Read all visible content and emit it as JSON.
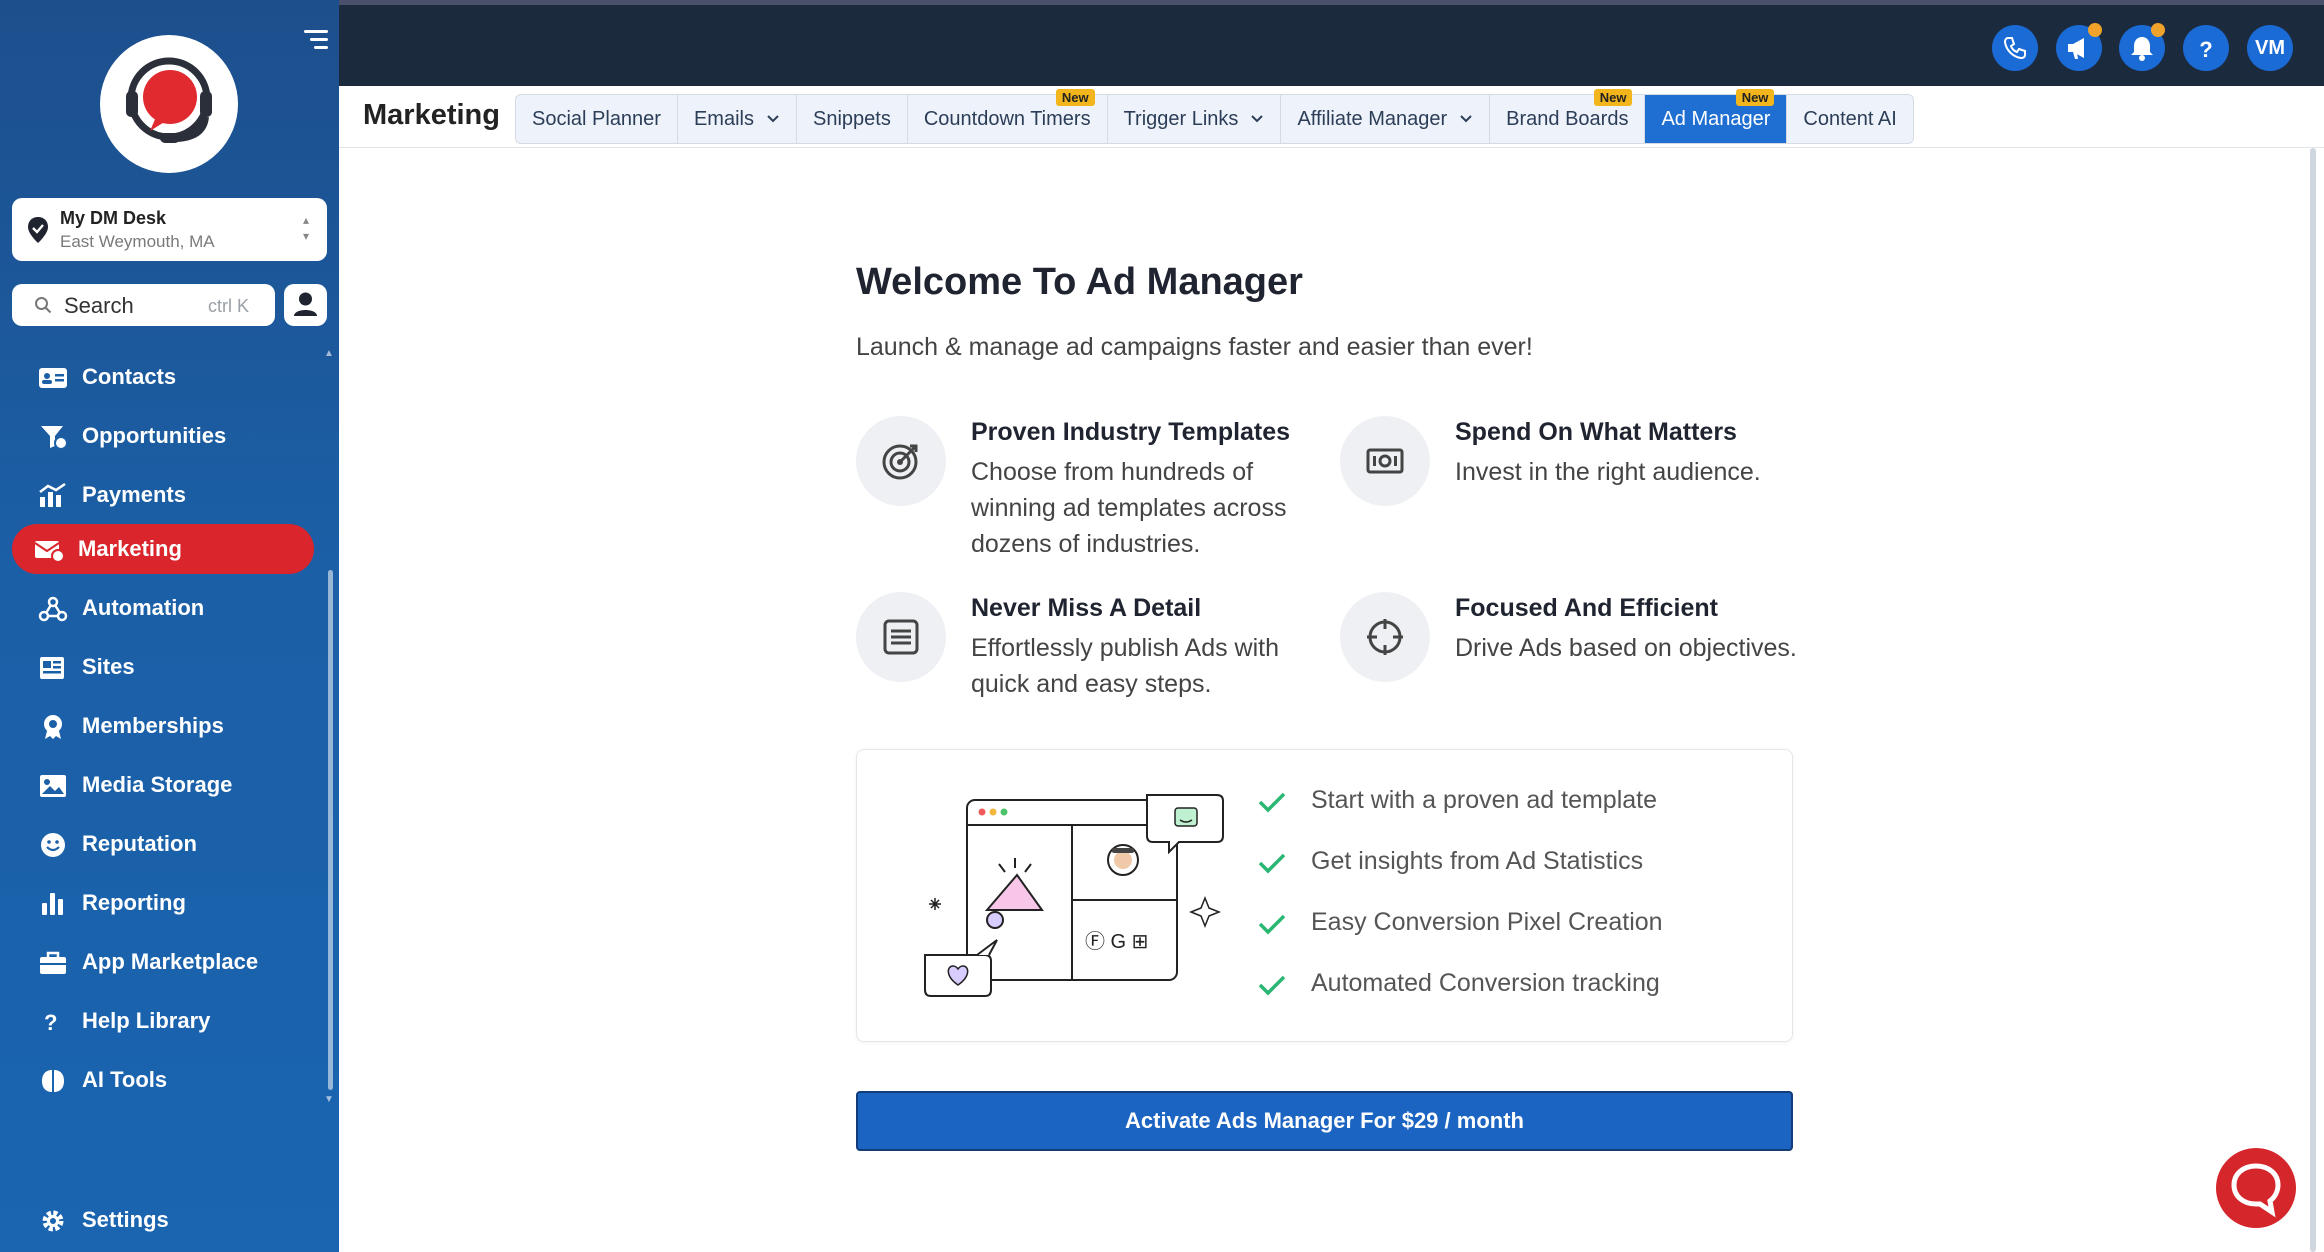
{
  "sidebar": {
    "location": {
      "name": "My DM Desk",
      "address": "East Weymouth, MA"
    },
    "search": {
      "label": "Search",
      "shortcut": "ctrl K"
    },
    "items": [
      {
        "label": "Contacts",
        "icon": "contacts-icon"
      },
      {
        "label": "Opportunities",
        "icon": "opportunities-icon"
      },
      {
        "label": "Payments",
        "icon": "payments-icon"
      },
      {
        "label": "Marketing",
        "icon": "marketing-icon",
        "active": true
      },
      {
        "label": "Automation",
        "icon": "automation-icon"
      },
      {
        "label": "Sites",
        "icon": "sites-icon"
      },
      {
        "label": "Memberships",
        "icon": "memberships-icon"
      },
      {
        "label": "Media Storage",
        "icon": "media-storage-icon"
      },
      {
        "label": "Reputation",
        "icon": "reputation-icon"
      },
      {
        "label": "Reporting",
        "icon": "reporting-icon"
      },
      {
        "label": "App Marketplace",
        "icon": "app-marketplace-icon"
      },
      {
        "label": "Help Library",
        "icon": "help-icon"
      },
      {
        "label": "AI Tools",
        "icon": "ai-tools-icon"
      }
    ],
    "settings": {
      "label": "Settings",
      "icon": "gear-icon"
    }
  },
  "topbar": {
    "avatar_initials": "VM",
    "help": "?"
  },
  "header": {
    "title": "Marketing",
    "tabs": [
      {
        "label": "Social Planner"
      },
      {
        "label": "Emails",
        "dropdown": true
      },
      {
        "label": "Snippets"
      },
      {
        "label": "Countdown Timers",
        "badge": "New"
      },
      {
        "label": "Trigger Links",
        "dropdown": true
      },
      {
        "label": "Affiliate Manager",
        "dropdown": true
      },
      {
        "label": "Brand Boards",
        "badge": "New"
      },
      {
        "label": "Ad Manager",
        "badge": "New",
        "active": true
      },
      {
        "label": "Content AI"
      }
    ]
  },
  "main": {
    "title": "Welcome To Ad Manager",
    "subtitle": "Launch & manage ad campaigns faster and easier than ever!",
    "features": [
      {
        "title": "Proven Industry Templates",
        "desc": "Choose from hundreds of winning ad templates across dozens of industries.",
        "icon": "target-icon"
      },
      {
        "title": "Spend On What Matters",
        "desc": "Invest in the right audience.",
        "icon": "money-icon"
      },
      {
        "title": "Never Miss A Detail",
        "desc": "Effortlessly publish Ads with quick and easy steps.",
        "icon": "list-icon"
      },
      {
        "title": "Focused And Efficient",
        "desc": "Drive Ads based on objectives.",
        "icon": "crosshair-icon"
      }
    ],
    "checklist": [
      "Start with a proven ad template",
      "Get insights from Ad Statistics",
      "Easy Conversion Pixel Creation",
      "Automated Conversion tracking"
    ],
    "cta": "Activate Ads Manager For $29 / month"
  },
  "colors": {
    "sidebar": "#1b5fa6",
    "active_nav": "#d9252b",
    "primary": "#1c64c2",
    "check": "#2bb673",
    "topbar": "#1c2a3e"
  }
}
